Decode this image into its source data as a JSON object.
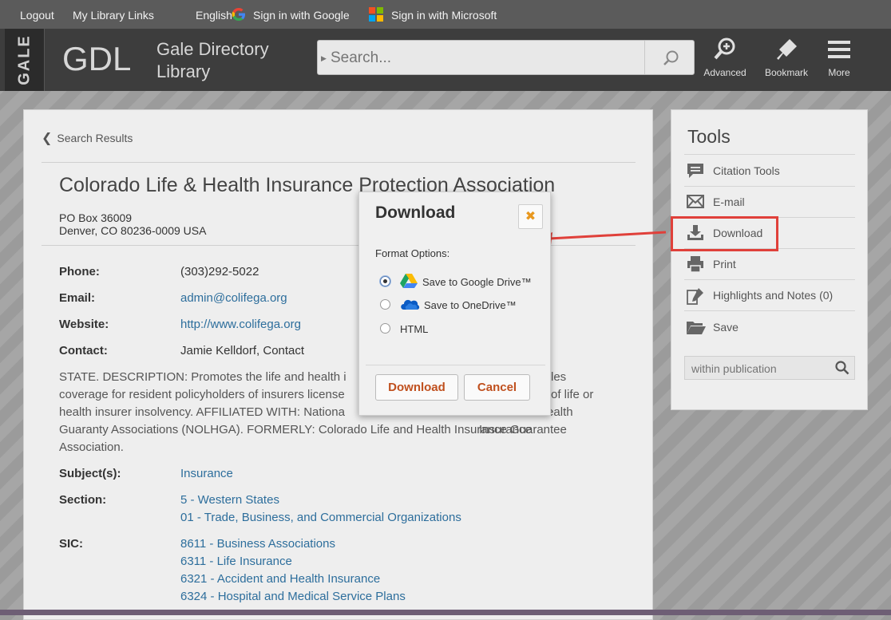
{
  "topbar": {
    "logout": "Logout",
    "library_links": "My Library Links",
    "language": "English",
    "google": "Sign in with Google",
    "microsoft": "Sign in with Microsoft"
  },
  "header": {
    "gale": "GALE",
    "gdl": "GDL",
    "subtitle_line1": "Gale Directory",
    "subtitle_line2": "Library",
    "search_placeholder": "Search...",
    "advanced": "Advanced",
    "bookmark": "Bookmark",
    "more": "More"
  },
  "main": {
    "breadcrumb": "Search Results",
    "title": "Colorado Life & Health Insurance Protection Association",
    "address_line1": "PO Box 36009",
    "address_line2": "Denver, CO 80236-0009 USA",
    "phone_label": "Phone:",
    "phone": "(303)292-5022",
    "email_label": "Email:",
    "email": "admin@colifega.org",
    "website_label": "Website:",
    "website": "http://www.colifega.org",
    "contact_label": "Contact:",
    "contact": "Jamie Kelldorf, Contact",
    "desc_line1": "STATE. DESCRIPTION: Promotes the life and health i",
    "desc_line1b": "les",
    "desc_line2": "coverage for resident policyholders of insurers license",
    "desc_line2b": "of life or",
    "desc_line3": "health insurer insolvency. AFFILIATED WITH: Nationa",
    "desc_line3b": "of Life and Health Insurance",
    "desc_line4": "Guaranty Associations (NOLHGA). FORMERLY: Colorado Life and Health Insurance Guarantee",
    "desc_line5": "Association.",
    "subjects_label": "Subject(s):",
    "subjects": "Insurance",
    "section_label": "Section:",
    "section1": "5 - Western States",
    "section2": "01 - Trade, Business, and Commercial Organizations",
    "sic_label": "SIC:",
    "sic1": "8611 - Business Associations",
    "sic2": "6311 - Life Insurance",
    "sic3": "6321 - Accident and Health Insurance",
    "sic4": "6324 - Hospital and Medical Service Plans"
  },
  "tools": {
    "title": "Tools",
    "items": [
      {
        "label": "Citation Tools",
        "icon": "citation-icon"
      },
      {
        "label": "E-mail",
        "icon": "email-icon"
      },
      {
        "label": "Download",
        "icon": "download-icon"
      },
      {
        "label": "Print",
        "icon": "print-icon"
      },
      {
        "label": "Highlights and Notes (0)",
        "icon": "highlight-icon"
      },
      {
        "label": "Save",
        "icon": "folder-icon"
      }
    ],
    "within_placeholder": "within publication"
  },
  "modal": {
    "title": "Download",
    "format_label": "Format Options:",
    "options": [
      {
        "label": "Save to Google Drive™",
        "selected": true
      },
      {
        "label": "Save to OneDrive™",
        "selected": false
      },
      {
        "label": "HTML",
        "selected": false
      }
    ],
    "download_button": "Download",
    "cancel_button": "Cancel"
  },
  "colors": {
    "accent_orange": "#c0501e",
    "highlight_red": "#e0403a",
    "link_blue": "#2d6e9c"
  }
}
